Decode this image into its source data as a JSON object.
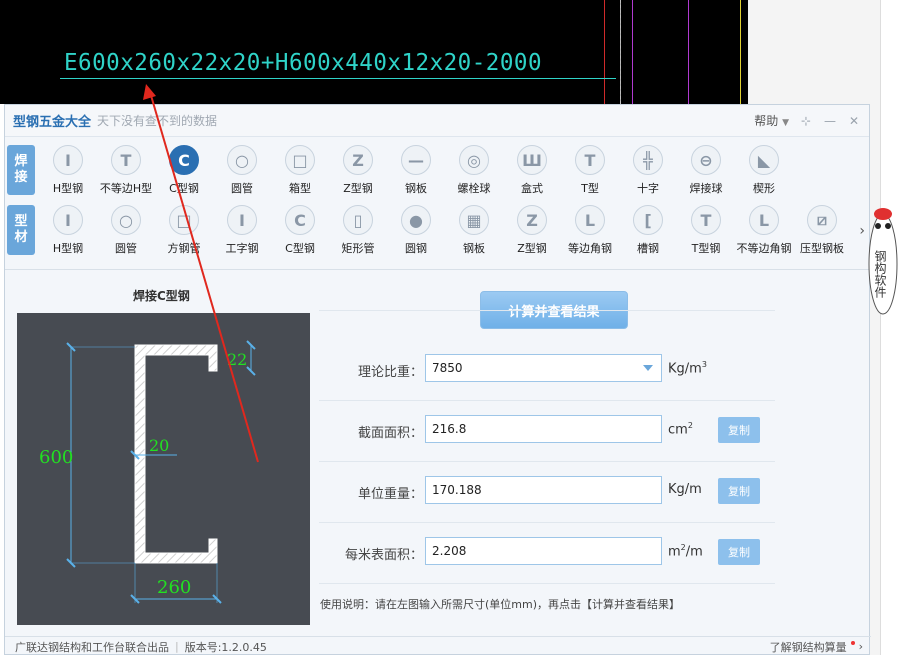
{
  "cad": {
    "annotation": "E600x260x22x20+H600x440x12x20-2000"
  },
  "window": {
    "title": "型钢五金大全",
    "subtitle": "天下没有查不到的数据",
    "help_label": "帮助"
  },
  "welded_row": {
    "label_top": "焊",
    "label_bottom": "接",
    "items": [
      {
        "label": "H型钢",
        "icon": "h-beam-icon",
        "glyph": "I"
      },
      {
        "label": "不等边H型",
        "icon": "unequal-h-icon",
        "glyph": "T"
      },
      {
        "label": "C型钢",
        "icon": "c-channel-icon",
        "glyph": "C",
        "active": true
      },
      {
        "label": "圆管",
        "icon": "round-pipe-icon",
        "glyph": "○"
      },
      {
        "label": "箱型",
        "icon": "box-icon",
        "glyph": "□"
      },
      {
        "label": "Z型钢",
        "icon": "z-steel-icon",
        "glyph": "Z"
      },
      {
        "label": "钢板",
        "icon": "plate-icon",
        "glyph": "—"
      },
      {
        "label": "螺栓球",
        "icon": "bolt-ball-icon",
        "glyph": "◎"
      },
      {
        "label": "盒式",
        "icon": "box-section-icon",
        "glyph": "Ш"
      },
      {
        "label": "T型",
        "icon": "t-section-icon",
        "glyph": "T"
      },
      {
        "label": "十字",
        "icon": "cross-icon",
        "glyph": "╬"
      },
      {
        "label": "焊接球",
        "icon": "welded-ball-icon",
        "glyph": "⊖"
      },
      {
        "label": "楔形",
        "icon": "wedge-icon",
        "glyph": "◣"
      }
    ]
  },
  "profile_row": {
    "label_top": "型",
    "label_bottom": "材",
    "items": [
      {
        "label": "H型钢",
        "icon": "h-beam-icon",
        "glyph": "I"
      },
      {
        "label": "圆管",
        "icon": "round-pipe-icon",
        "glyph": "○"
      },
      {
        "label": "方钢管",
        "icon": "square-pipe-icon",
        "glyph": "□"
      },
      {
        "label": "工字钢",
        "icon": "i-beam-icon",
        "glyph": "I"
      },
      {
        "label": "C型钢",
        "icon": "c-channel-icon",
        "glyph": "C"
      },
      {
        "label": "矩形管",
        "icon": "rect-pipe-icon",
        "glyph": "▯"
      },
      {
        "label": "圆钢",
        "icon": "round-bar-icon",
        "glyph": "●"
      },
      {
        "label": "钢板",
        "icon": "plate-icon",
        "glyph": "▦"
      },
      {
        "label": "Z型钢",
        "icon": "z-steel-icon",
        "glyph": "Z"
      },
      {
        "label": "等边角钢",
        "icon": "equal-angle-icon",
        "glyph": "L"
      },
      {
        "label": "槽钢",
        "icon": "channel-icon",
        "glyph": "["
      },
      {
        "label": "T型钢",
        "icon": "t-steel-icon",
        "glyph": "T"
      },
      {
        "label": "不等边角钢",
        "icon": "unequal-angle-icon",
        "glyph": "L"
      },
      {
        "label": "压型钢板",
        "icon": "deck-plate-icon",
        "glyph": "⧄"
      }
    ]
  },
  "drawing": {
    "title": "焊接C型钢",
    "dim_height": "600",
    "dim_lip": "22",
    "dim_web": "20",
    "dim_width": "260"
  },
  "calc": {
    "button_label": "计算并查看结果",
    "density": {
      "label": "理论比重：",
      "value": "7850",
      "unit": "Kg/m",
      "unit_sup": "3"
    },
    "area": {
      "label": "截面面积：",
      "value": "216.8",
      "unit": "cm",
      "unit_sup": "2",
      "copy": "复制"
    },
    "weight": {
      "label": "单位重量：",
      "value": "170.188",
      "unit": "Kg/m",
      "copy": "复制"
    },
    "surface": {
      "label": "每米表面积：",
      "value": "2.208",
      "unit_pre": "m",
      "unit_sup": "2",
      "unit_post": "/m",
      "copy": "复制"
    },
    "note": "使用说明：请在左图输入所需尺寸(单位mm)，再点击【计算并查看结果】"
  },
  "status": {
    "left": "广联达钢结构和工作台联合出品",
    "version": "版本号:1.2.0.45",
    "right": "了解钢结构算量"
  },
  "mascot": {
    "text": "钢构软件"
  }
}
